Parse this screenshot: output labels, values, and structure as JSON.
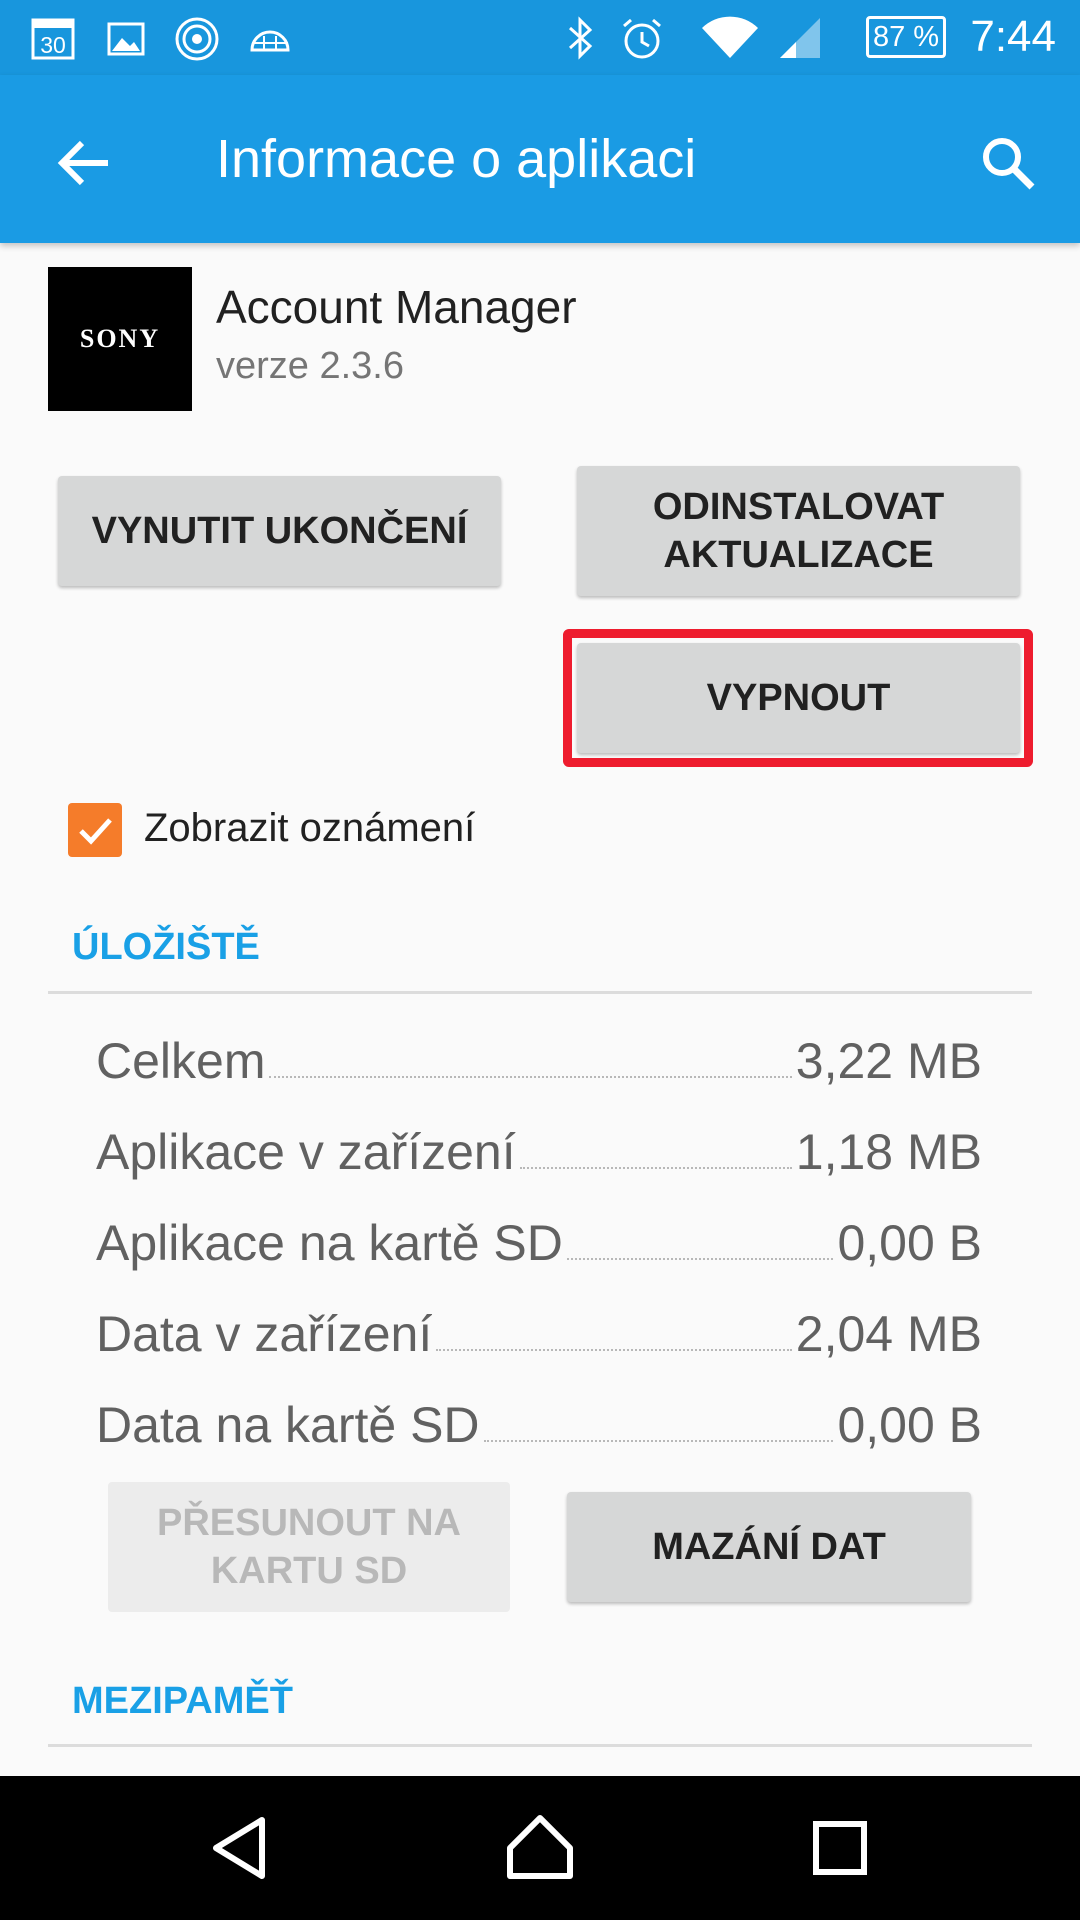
{
  "status_bar": {
    "calendar_day": "30",
    "battery_percent": "87 %",
    "time": "7:44",
    "icons": [
      "calendar-icon",
      "image-icon",
      "hotspot-icon",
      "igloo-icon",
      "bluetooth-icon",
      "alarm-icon",
      "wifi-icon",
      "signal-icon",
      "battery-icon"
    ]
  },
  "app_bar": {
    "title": "Informace o aplikaci",
    "back_icon": "arrow-back-icon",
    "search_icon": "search-icon"
  },
  "app": {
    "icon_text": "SONY",
    "name": "Account Manager",
    "version": "verze 2.3.6"
  },
  "actions": {
    "force_stop": "VYNUTIT UKONČENÍ",
    "uninstall_updates_line1": "ODINSTALOVAT",
    "uninstall_updates_line2": "AKTUALIZACE",
    "disable": "VYPNOUT"
  },
  "notifications": {
    "label": "Zobrazit oznámení",
    "checked": true
  },
  "storage": {
    "header": "ÚLOŽIŠTĚ",
    "rows": [
      {
        "label": "Celkem",
        "value": "3,22 MB"
      },
      {
        "label": "Aplikace v zařízení",
        "value": "1,18 MB"
      },
      {
        "label": "Aplikace na kartě SD",
        "value": "0,00 B"
      },
      {
        "label": "Data v zařízení",
        "value": "2,04 MB"
      },
      {
        "label": "Data na kartě SD",
        "value": "0,00 B"
      }
    ],
    "move_to_sd_line1": "PŘESUNOUT NA",
    "move_to_sd_line2": "KARTU SD",
    "clear_data": "MAZÁNÍ DAT"
  },
  "cache": {
    "header": "MEZIPAMĚŤ"
  },
  "colors": {
    "status_bar": "#1896dd",
    "app_bar": "#1a9be4",
    "accent": "#19a0e6",
    "checkbox": "#f57c2a",
    "highlight": "#ee1c2e"
  }
}
